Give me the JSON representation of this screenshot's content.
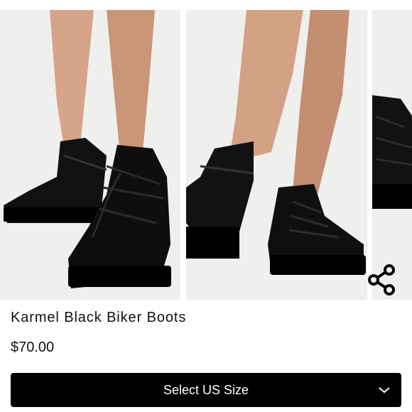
{
  "product": {
    "title": "Karmel Black Biker Boots",
    "price": "$70.00"
  },
  "gallery": {
    "images": [
      {
        "icon": "boot-photo-front"
      },
      {
        "icon": "boot-photo-side"
      },
      {
        "icon": "boot-photo-partial"
      }
    ],
    "share_icon": "share-icon"
  },
  "size_select": {
    "label": "Select US Size",
    "icon": "chevron-down-icon"
  },
  "colors": {
    "background": "#ffffff",
    "photo_bg": "#efefee",
    "button_bg": "#000000",
    "button_text": "#ffffff"
  }
}
